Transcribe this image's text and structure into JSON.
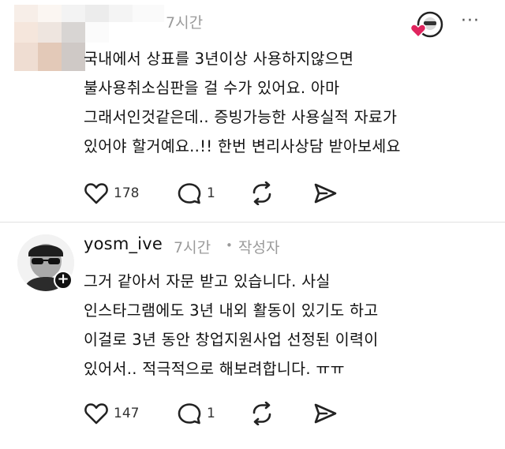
{
  "comments": [
    {
      "username": "",
      "time": "7시간",
      "more_label": "···",
      "body_lines": [
        "국내에서 상표를 3년이상 사용하지않으면",
        "불사용취소심판을 걸 수가 있어요. 아마",
        "그래서인것같은데.. 증빙가능한 사용실적 자료가",
        "있어야 할거예요..!! 한번 변리사상담 받아보세요"
      ],
      "like_count": "178",
      "reply_count": "1",
      "liked_by_author": true
    },
    {
      "username": "yosm_ive",
      "time": "7시간",
      "separator": "•",
      "author_tag": "작성자",
      "follow_label": "+",
      "body_lines": [
        "그거 같아서 자문 받고 있습니다. 사실",
        "인스타그램에도 3년 내외 활동이 있기도 하고",
        "이걸로 3년 동안 창업지원사업 선정된 이력이",
        "있어서.. 적극적으로 해보려합니다. ㅠㅠ"
      ],
      "like_count": "147",
      "reply_count": "1"
    }
  ],
  "icons": {
    "like": "heart-outline-icon",
    "reply": "speech-bubble-icon",
    "repost": "repost-icon",
    "share": "send-icon",
    "liked_badge": "red-heart-icon"
  },
  "colors": {
    "heart_badge": "#e0245e",
    "muted": "#9a9a9a"
  }
}
